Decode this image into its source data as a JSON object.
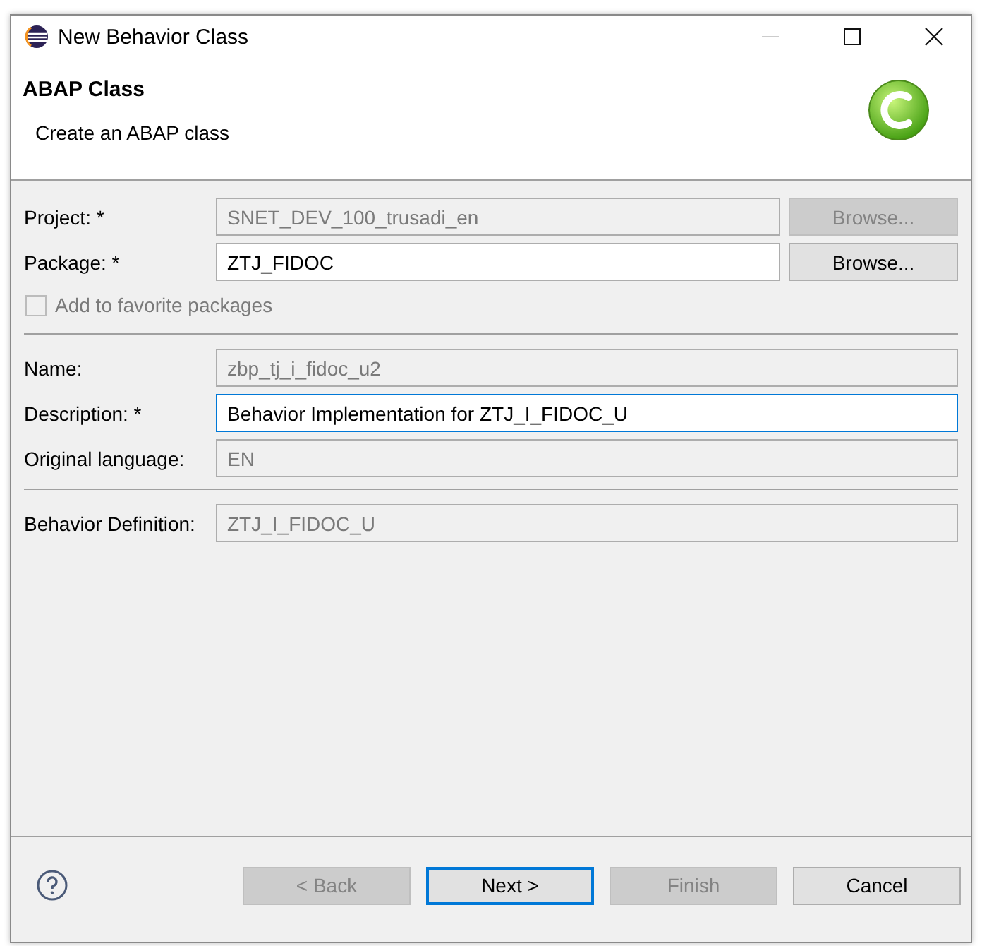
{
  "window": {
    "title": "New Behavior Class"
  },
  "header": {
    "title": "ABAP Class",
    "subtitle": "Create an ABAP class"
  },
  "groups": [
    {
      "rows": [
        {
          "kind": "field",
          "label": "Project: *",
          "value": "SNET_DEV_100_trusadi_en",
          "disabled": true,
          "focused": false,
          "button": {
            "label": "Browse...",
            "disabled": true
          }
        },
        {
          "kind": "field",
          "label": "Package: *",
          "value": "ZTJ_FIDOC",
          "disabled": false,
          "focused": false,
          "button": {
            "label": "Browse...",
            "disabled": false
          }
        },
        {
          "kind": "checkbox",
          "label": "Add to favorite packages",
          "checked": false,
          "disabled": true
        }
      ]
    },
    {
      "rows": [
        {
          "kind": "field",
          "label": "Name:",
          "value": "zbp_tj_i_fidoc_u2",
          "disabled": true,
          "focused": false
        },
        {
          "kind": "field",
          "label": "Description: *",
          "value": "Behavior Implementation for ZTJ_I_FIDOC_U",
          "disabled": false,
          "focused": true
        },
        {
          "kind": "field",
          "label": "Original language:",
          "value": "EN",
          "disabled": true,
          "focused": false
        }
      ]
    },
    {
      "rows": [
        {
          "kind": "field",
          "label": "Behavior Definition:",
          "value": "ZTJ_I_FIDOC_U",
          "disabled": true,
          "focused": false
        }
      ]
    }
  ],
  "buttons": [
    {
      "label": "< Back",
      "disabled": true,
      "default": false
    },
    {
      "label": "Next >",
      "disabled": false,
      "default": true
    },
    {
      "label": "Finish",
      "disabled": true,
      "default": false
    },
    {
      "label": "Cancel",
      "disabled": false,
      "default": false
    }
  ]
}
